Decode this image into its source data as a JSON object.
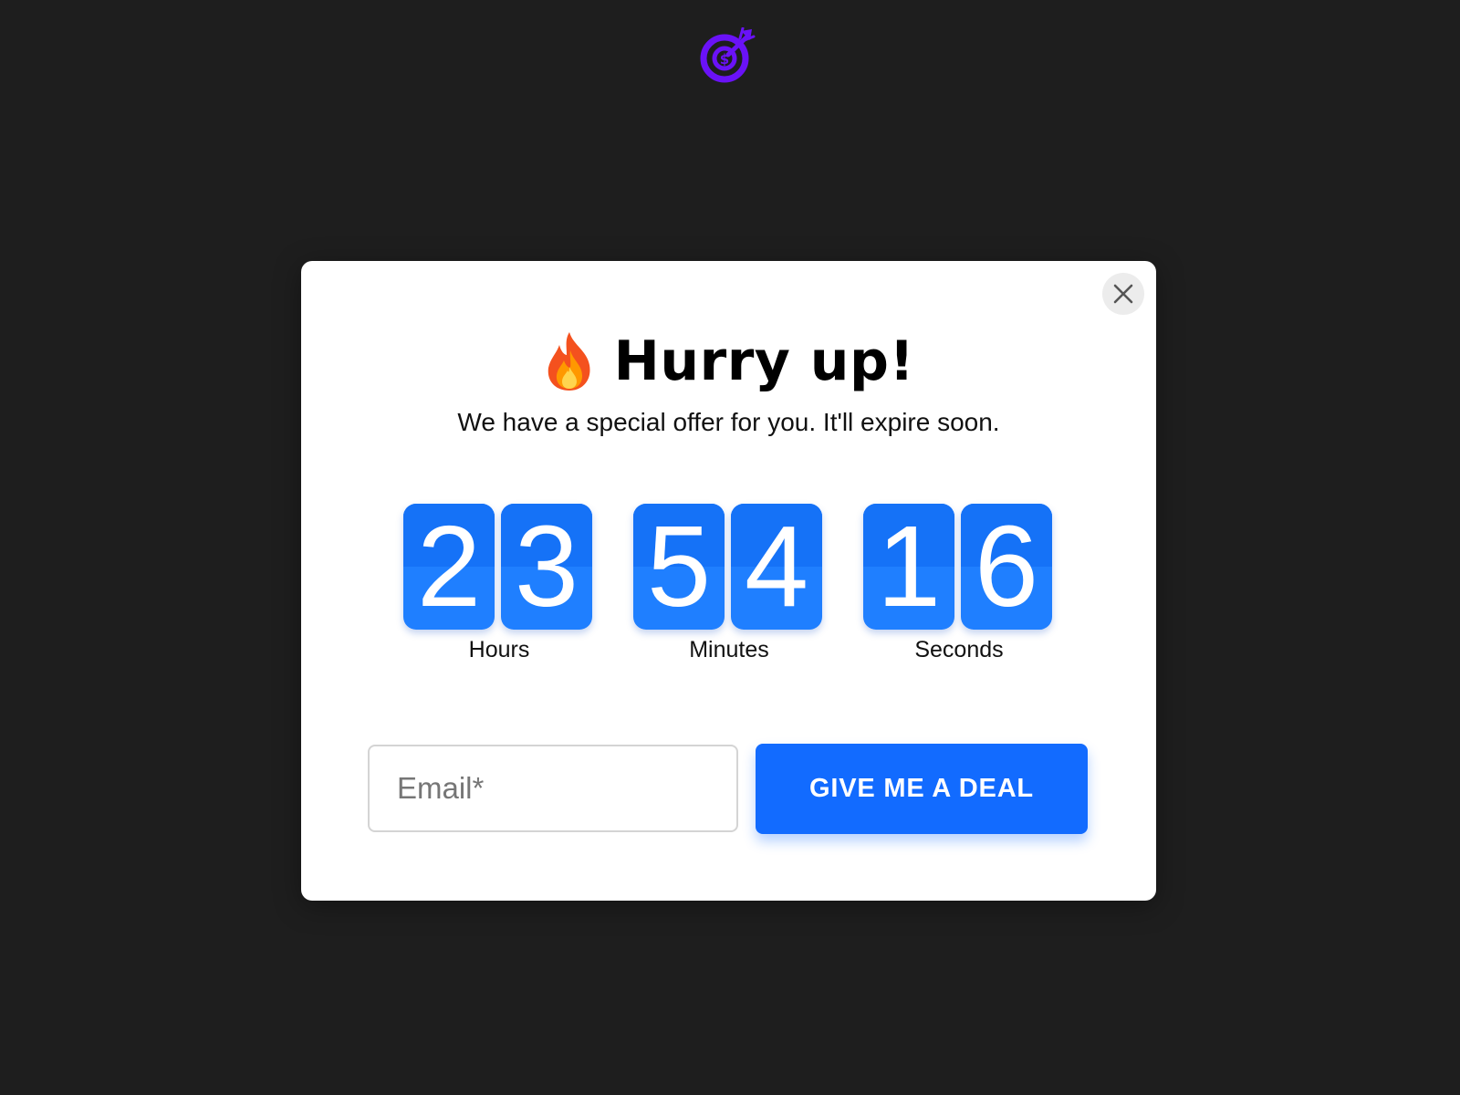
{
  "logo": {
    "icon": "target-dollar-icon",
    "color": "#6a12f7"
  },
  "popup": {
    "close_icon": "close-icon",
    "title_icon": "fire-icon",
    "title": "Hurry up!",
    "subtitle": "We have a special offer for you. It'll expire soon.",
    "countdown": {
      "hours": {
        "digits": [
          "2",
          "3"
        ],
        "label": "Hours"
      },
      "minutes": {
        "digits": [
          "5",
          "4"
        ],
        "label": "Minutes"
      },
      "seconds": {
        "digits": [
          "1",
          "6"
        ],
        "label": "Seconds"
      }
    },
    "email": {
      "placeholder": "Email*",
      "value": ""
    },
    "cta_label": "GIVE ME A DEAL"
  },
  "colors": {
    "background": "#1e1e1e",
    "accent": "#126bff",
    "digit_tile": "#1f7fff"
  }
}
